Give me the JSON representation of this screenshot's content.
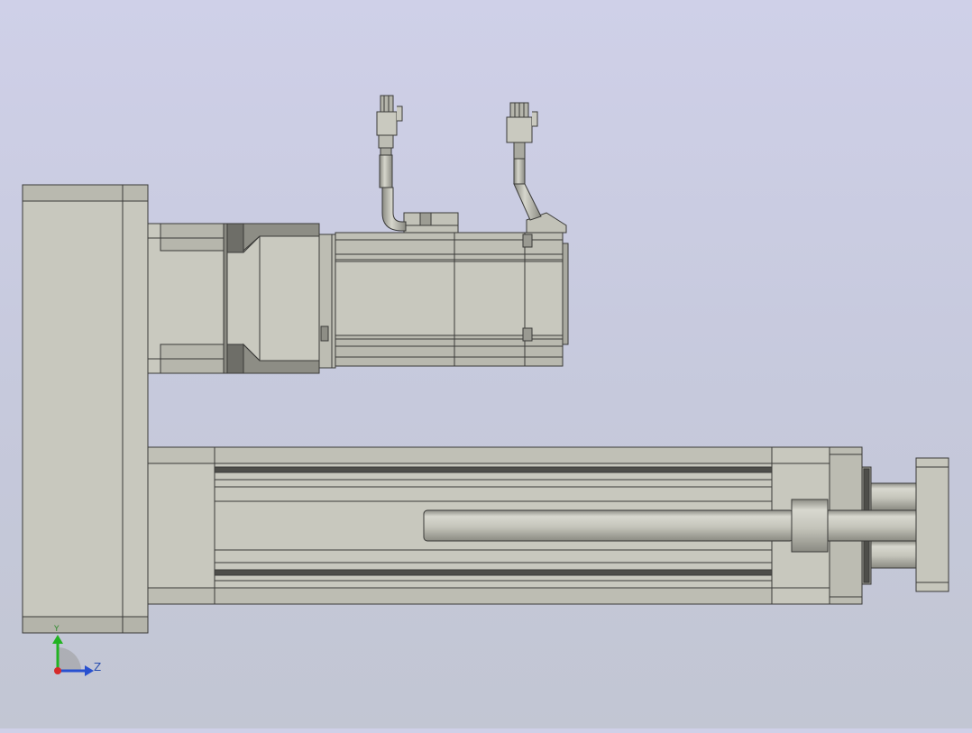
{
  "viewport": {
    "background_top": "#cfd0e8",
    "background_bottom": "#c2c6d3"
  },
  "model": {
    "body_color": "#c9c9bf",
    "shade_color": "#9b9b92",
    "dark_color": "#4a4a46",
    "edge_color": "#3a3a38"
  },
  "triad": {
    "x_color": "#d62a2a",
    "y_color": "#22b322",
    "z_color": "#2850d0",
    "y_label": "Y",
    "z_label": "Z"
  }
}
